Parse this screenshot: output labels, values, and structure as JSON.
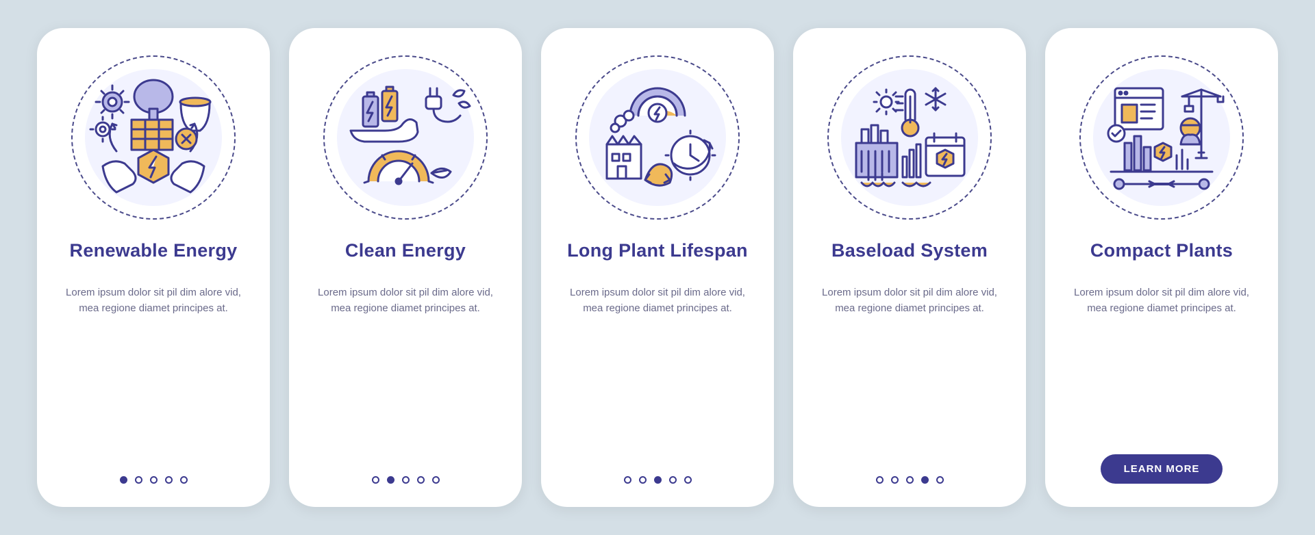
{
  "colors": {
    "background": "#d4dfe6",
    "screen_bg": "#ffffff",
    "title": "#3c3a8f",
    "desc": "#6a6a8a",
    "accent_yellow": "#f0b95a",
    "accent_lavender": "#b8b8e8",
    "button_bg": "#3c3a8f",
    "button_text": "#ffffff",
    "outline": "#3c3a8f"
  },
  "screens": [
    {
      "id": "renewable-energy",
      "title": "Renewable Energy",
      "description": "Lorem ipsum dolor sit pil dim alore vid, mea regione diamet principes at.",
      "active_dot": 0,
      "total_dots": 5,
      "has_cta": false
    },
    {
      "id": "clean-energy",
      "title": "Clean Energy",
      "description": "Lorem ipsum dolor sit pil dim alore vid, mea regione diamet principes at.",
      "active_dot": 1,
      "total_dots": 5,
      "has_cta": false
    },
    {
      "id": "long-plant-lifespan",
      "title": "Long Plant Lifespan",
      "description": "Lorem ipsum dolor sit pil dim alore vid, mea regione diamet principes at.",
      "active_dot": 2,
      "total_dots": 5,
      "has_cta": false
    },
    {
      "id": "baseload-system",
      "title": "Baseload System",
      "description": "Lorem ipsum dolor sit pil dim alore vid, mea regione diamet principes at.",
      "active_dot": 3,
      "total_dots": 5,
      "has_cta": false
    },
    {
      "id": "compact-plants",
      "title": "Compact Plants",
      "description": "Lorem ipsum dolor sit pil dim alore vid, mea regione diamet principes at.",
      "active_dot": 4,
      "total_dots": 5,
      "has_cta": true,
      "cta_label": "LEARN MORE"
    }
  ]
}
